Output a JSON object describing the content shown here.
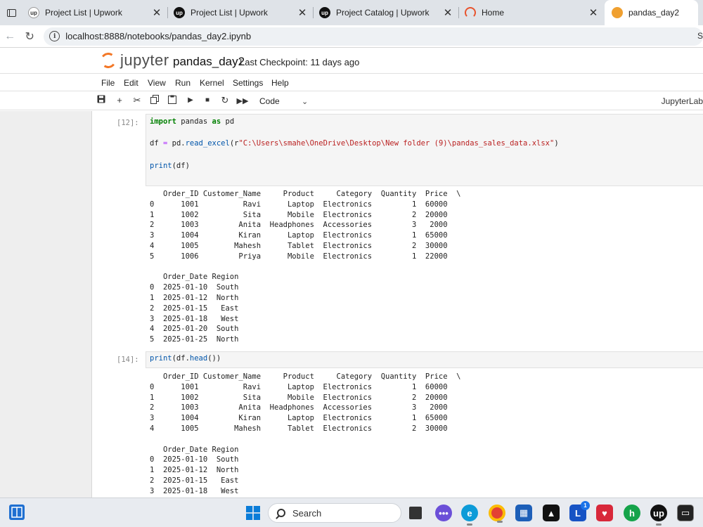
{
  "browser": {
    "tabs": [
      {
        "title": "Project List | Upwork",
        "icon": "upwork-icon"
      },
      {
        "title": "Project List | Upwork",
        "icon": "upwork-icon"
      },
      {
        "title": "Project Catalog | Upwork",
        "icon": "upwork-icon"
      },
      {
        "title": "Home",
        "icon": "jupyter-home-icon"
      },
      {
        "title": "pandas_day2",
        "icon": "notebook-icon"
      }
    ],
    "url": "localhost:8888/notebooks/pandas_day2.ipynb",
    "right_cut": "S"
  },
  "jupyter": {
    "logo_text": "jupyter",
    "notebook_name": "pandas_day2",
    "checkpoint": "Last Checkpoint: 11 days ago",
    "menu": [
      "File",
      "Edit",
      "View",
      "Run",
      "Kernel",
      "Settings",
      "Help"
    ],
    "cell_type": "Code",
    "kernel_label": "JupyterLab"
  },
  "cells": [
    {
      "prompt": "[12]:",
      "code": {
        "line1_kw1": "import",
        "line1_a": " pandas ",
        "line1_kw2": "as",
        "line1_b": " pd",
        "line2_a": "df ",
        "line2_op": "=",
        "line2_b": " pd.",
        "line2_fn": "read_excel",
        "line2_c": "(r",
        "line2_str": "\"C:\\Users\\smahe\\OneDrive\\Desktop\\New folder (9)\\pandas_sales_data.xlsx\"",
        "line2_d": ")",
        "line3_fn": "print",
        "line3_a": "(df)"
      },
      "output": [
        "   Order_ID Customer_Name     Product     Category  Quantity  Price  \\",
        "0      1001          Ravi      Laptop  Electronics         1  60000  ",
        "1      1002          Sita      Mobile  Electronics         2  20000  ",
        "2      1003         Anita  Headphones  Accessories         3   2000  ",
        "3      1004         Kiran      Laptop  Electronics         1  65000  ",
        "4      1005        Mahesh      Tablet  Electronics         2  30000  ",
        "5      1006         Priya      Mobile  Electronics         1  22000  ",
        "",
        "   Order_Date Region",
        "0  2025-01-10  South",
        "1  2025-01-12  North",
        "2  2025-01-15   East",
        "3  2025-01-18   West",
        "4  2025-01-20  South",
        "5  2025-01-25  North"
      ]
    },
    {
      "prompt": "[14]:",
      "code": {
        "line1_fn": "print",
        "line1_a": "(df.",
        "line1_fn2": "head",
        "line1_b": "())"
      },
      "output": [
        "   Order_ID Customer_Name     Product     Category  Quantity  Price  \\",
        "0      1001          Ravi      Laptop  Electronics         1  60000  ",
        "1      1002          Sita      Mobile  Electronics         2  20000  ",
        "2      1003         Anita  Headphones  Accessories         3   2000  ",
        "3      1004         Kiran      Laptop  Electronics         1  65000  ",
        "4      1005        Mahesh      Tablet  Electronics         2  30000  ",
        "",
        "   Order_Date Region",
        "0  2025-01-10  South",
        "1  2025-01-12  North",
        "2  2025-01-15   East",
        "3  2025-01-18   West"
      ]
    }
  ],
  "taskbar": {
    "search_label": "Search",
    "l_badge": "1",
    "colors": {
      "accent": "#1a73e8",
      "jupyter_orange": "#f37726"
    }
  }
}
